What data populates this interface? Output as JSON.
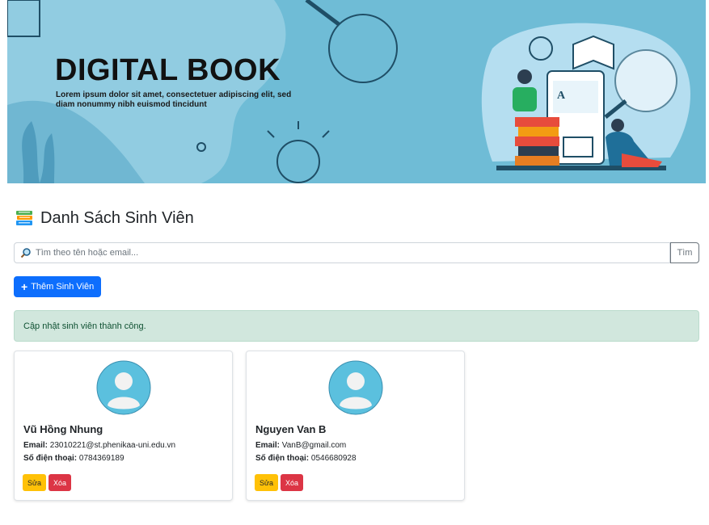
{
  "banner": {
    "title": "DIGITAL BOOK",
    "subtitle": "Lorem ipsum dolor sit amet, consectetuer adipiscing elit, sed diam nonummy nibh euismod tincidunt"
  },
  "page": {
    "heading": "Danh Sách Sinh Viên",
    "heading_icon": "books-icon"
  },
  "search": {
    "placeholder": "Tìm theo tên hoặc email...",
    "button_label": "Tìm",
    "icon": "search-icon"
  },
  "add_button": {
    "label": "Thêm Sinh Viên",
    "icon": "plus-icon"
  },
  "alert": {
    "message": "Cập nhật sinh viên thành công."
  },
  "labels": {
    "email": "Email:",
    "phone": "Số điện thoại:",
    "edit": "Sửa",
    "delete": "Xóa"
  },
  "students": [
    {
      "name": "Vũ Hồng Nhung",
      "email": "23010221@st.phenikaa-uni.edu.vn",
      "phone": "0784369189"
    },
    {
      "name": "Nguyen Van B",
      "email": "VanB@gmail.com",
      "phone": "0546680928"
    }
  ],
  "colors": {
    "primary": "#0d6efd",
    "warning": "#ffc107",
    "danger": "#dc3545",
    "success_bg": "#d1e7dd",
    "banner_bg": "#6fbcd6",
    "avatar_bg": "#5bc0de"
  }
}
